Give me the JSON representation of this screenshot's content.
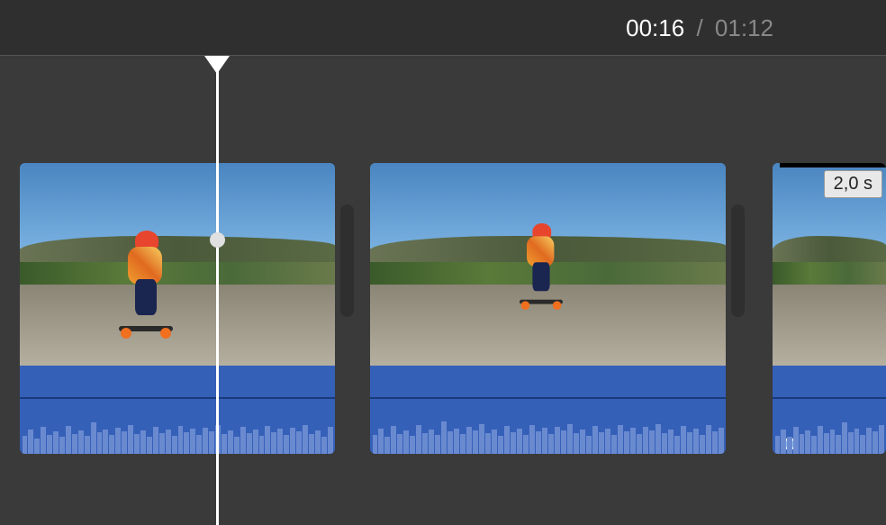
{
  "header": {
    "timecode_current": "00:16",
    "timecode_separator": "/",
    "timecode_total": "01:12"
  },
  "timeline": {
    "clip3_duration_badge": "2,0 s"
  }
}
